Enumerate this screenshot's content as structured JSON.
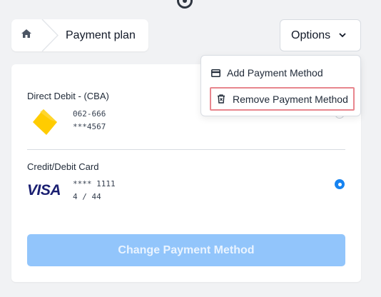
{
  "breadcrumb": {
    "home_icon": "home-icon",
    "current": "Payment plan"
  },
  "options": {
    "label": "Options",
    "icon": "chevron-down-icon",
    "menu": [
      {
        "label": "Add Payment Method",
        "icon": "credit-card-icon"
      },
      {
        "label": "Remove Payment Method",
        "icon": "trash-icon",
        "highlighted": true
      }
    ]
  },
  "payment_methods": [
    {
      "title": "Direct Debit - (CBA)",
      "logo": "cba-logo",
      "line1": "062-666",
      "line2": "***4567",
      "selected": false
    },
    {
      "title": "Credit/Debit Card",
      "logo": "visa-logo",
      "line1": "**** 1111",
      "line2": "4 / 44",
      "selected": true
    }
  ],
  "primary_action": "Change Payment Method",
  "colors": {
    "accent": "#1683f0",
    "primary_button": "#92c5fb",
    "highlight_border": "#e8868e",
    "visa_blue": "#1a1f71",
    "cba_yellow": "#ffcc00"
  }
}
